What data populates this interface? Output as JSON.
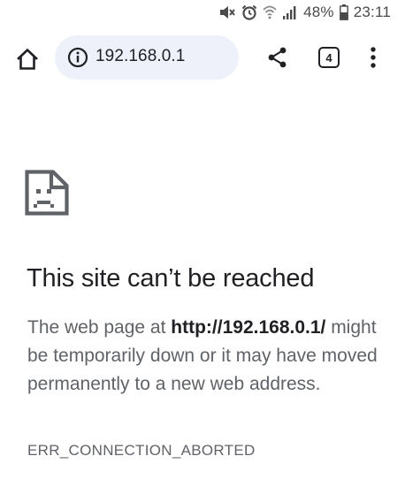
{
  "status_bar": {
    "battery": "48%",
    "time": "23:11",
    "icons": [
      "mute-icon",
      "alarm-icon",
      "wifi-icon",
      "signal-icon",
      "battery-icon"
    ]
  },
  "toolbar": {
    "url": "192.168.0.1",
    "tab_count": "4",
    "icons": [
      "home-icon",
      "info-icon",
      "share-icon",
      "tabs-icon",
      "more-vert-icon"
    ]
  },
  "error": {
    "title": "This site can’t be reached",
    "desc_prefix": "The web page at ",
    "desc_url": "http://192.168.0.1/",
    "desc_suffix": " might be temporarily down or it may have moved permanently to a new web address.",
    "code": "ERR_CONNECTION_ABORTED",
    "icon": "sad-page-icon"
  }
}
